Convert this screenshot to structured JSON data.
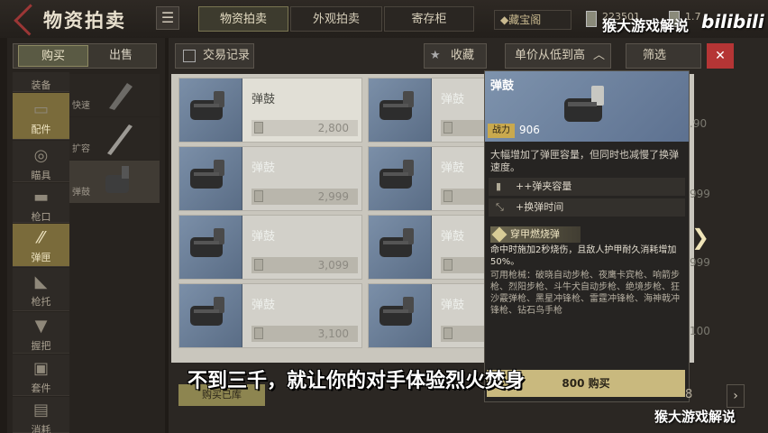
{
  "header": {
    "title": "物资拍卖",
    "tabs": [
      {
        "label": "物资拍卖",
        "active": true
      },
      {
        "label": "外观拍卖",
        "active": false
      },
      {
        "label": "寄存柜",
        "active": false
      }
    ],
    "vault_label": "◆藏宝阁",
    "currency1": "223501",
    "currency2": "1.7"
  },
  "watermark": {
    "top": "猴大游戏解说",
    "logo": "bilibili",
    "bottom": "猴大游戏解说"
  },
  "left": {
    "buy": "购买",
    "sell": "出售",
    "categories": [
      {
        "label": "装备",
        "icon": "helmet-icon"
      },
      {
        "label": "配件",
        "icon": "attachment-icon",
        "active": true
      },
      {
        "label": "瞄具",
        "icon": "scope-icon"
      },
      {
        "label": "枪口",
        "icon": "muzzle-icon"
      },
      {
        "label": "弹匣",
        "icon": "magazine-icon",
        "active": true
      },
      {
        "label": "枪托",
        "icon": "stock-icon"
      },
      {
        "label": "握把",
        "icon": "grip-icon"
      },
      {
        "label": "套件",
        "icon": "kit-icon"
      },
      {
        "label": "消耗",
        "icon": "consumable-icon"
      }
    ],
    "subitems": [
      {
        "label": "快速"
      },
      {
        "label": "扩容"
      },
      {
        "label": "弹鼓",
        "active": true
      }
    ]
  },
  "toolbar": {
    "records": "交易记录",
    "favorite": "收藏",
    "sort": "单价从低到高",
    "filter": "筛选",
    "close": "✕"
  },
  "grid": {
    "items": [
      {
        "name": "弹鼓",
        "price": "2,800",
        "highlight": true
      },
      {
        "name": "弹鼓",
        "price": ""
      },
      {
        "name": "弹鼓",
        "price": "2,999"
      },
      {
        "name": "弹鼓",
        "price": ""
      },
      {
        "name": "弹鼓",
        "price": "3,099"
      },
      {
        "name": "弹鼓",
        "price": ""
      },
      {
        "name": "弹鼓",
        "price": "3,100"
      },
      {
        "name": "弹鼓",
        "price": ""
      }
    ],
    "side_prices": [
      ".90",
      "999",
      "999",
      "100"
    ]
  },
  "detail": {
    "name": "弹鼓",
    "power_label": "战力",
    "power_value": "906",
    "description": "大幅增加了弹匣容量，但同时也减慢了换弹速度。",
    "attrs": [
      {
        "text": "++弹夹容量",
        "icon": "magazine-capacity-icon"
      },
      {
        "text": "+换弹时间",
        "icon": "reload-time-icon"
      }
    ],
    "tag": "穿甲燃烧弹",
    "effect": "命中时施加2秒烧伤，且敌人护甲耐久消耗增加50%。",
    "guns": "可用枪械：破晓自动步枪、夜鹰卡宾枪、响箭步枪、烈阳步枪、斗牛犬自动步枪、绝境步枪、狂沙霰弹枪、黑星冲锋枪、雷霆冲锋枪、海神戟冲锋枪、钻石鸟手枪",
    "buy": "800 购买"
  },
  "footer": {
    "bulk_buy": "购买已库",
    "page": "8",
    "next": "›"
  },
  "subtitle": "不到三千，就让你的对手体验烈火焚身"
}
